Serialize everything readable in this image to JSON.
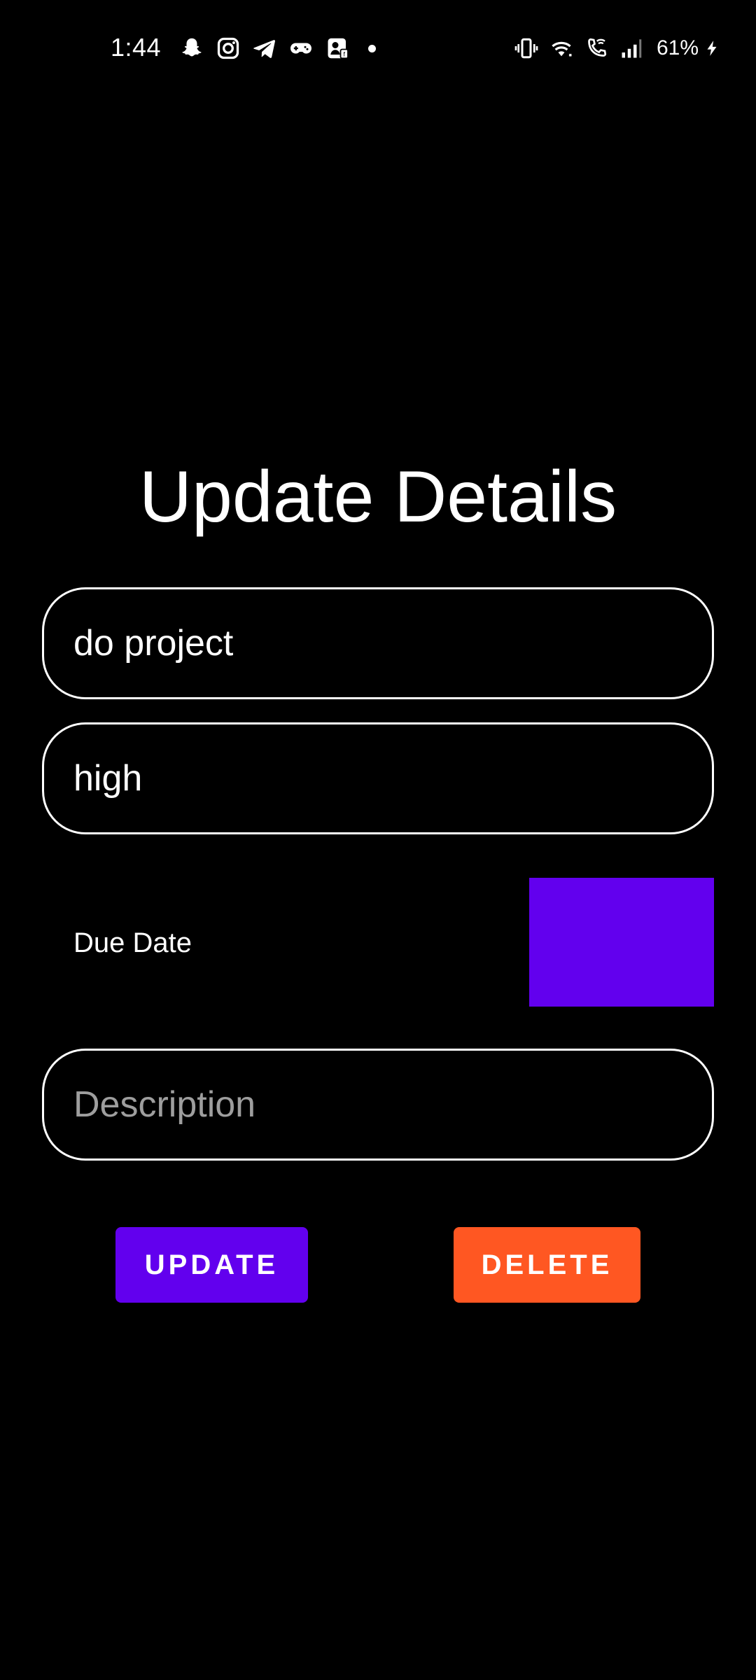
{
  "status_bar": {
    "time": "1:44",
    "battery": "61%",
    "left_icons": [
      "snapchat-icon",
      "instagram-icon",
      "telegram-icon",
      "gamepad-icon",
      "app-notification-icon",
      "more-notifications-dot"
    ],
    "right_icons": [
      "vibrate-icon",
      "wifi-icon",
      "wifi-calling-icon",
      "signal-icon",
      "battery-charging-icon"
    ]
  },
  "page": {
    "title": "Update Details"
  },
  "form": {
    "title_value": "do project",
    "priority_value": "high",
    "due_date_label": "Due Date",
    "description_placeholder": "Description",
    "description_value": ""
  },
  "actions": {
    "update_label": "UPDATE",
    "delete_label": "DELETE"
  },
  "colors": {
    "background": "#000000",
    "primary": "#6200ee",
    "danger": "#ff5722",
    "text": "#ffffff",
    "placeholder": "#9e9e9e"
  }
}
